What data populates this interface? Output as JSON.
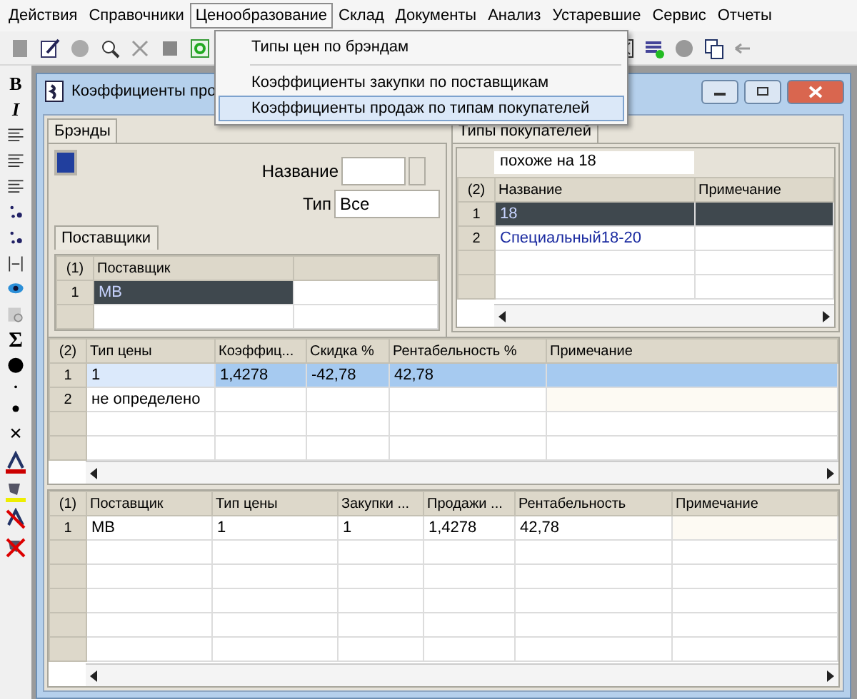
{
  "menu_bar": [
    {
      "label": "Действия",
      "selected": false
    },
    {
      "label": "Справочники",
      "selected": false
    },
    {
      "label": "Ценообразование",
      "selected": true
    },
    {
      "label": "Склад",
      "selected": false
    },
    {
      "label": "Документы",
      "selected": false
    },
    {
      "label": "Анализ",
      "selected": false
    },
    {
      "label": "Устаревшие",
      "selected": false
    },
    {
      "label": "Сервис",
      "selected": false
    },
    {
      "label": "Отчеты",
      "selected": false
    }
  ],
  "dropdown": [
    {
      "label": "Типы цен по брэндам",
      "selected": false,
      "separator_after": true
    },
    {
      "label": "Коэффициенты закупки по поставщикам",
      "selected": false,
      "separator_after": false
    },
    {
      "label": "Коэффициенты продаж по типам покупателей",
      "selected": true,
      "separator_after": false
    }
  ],
  "format_toolbar": {
    "bold": "B",
    "italic": "I",
    "sum": "Σ",
    "remove": "×"
  },
  "window": {
    "title": "Коэффициенты про"
  },
  "brands": {
    "tab": "Брэнды",
    "name_label": "Название",
    "type_label": "Тип",
    "type_value": "Все"
  },
  "suppliers": {
    "tab": "Поставщики",
    "count": "(1)",
    "columns": [
      "Поставщик"
    ],
    "rows": [
      {
        "number": "1",
        "cells": [
          "МВ"
        ],
        "selected": true
      }
    ]
  },
  "buyer_types": {
    "tab": "Типы покупателей",
    "filter": "похоже на 18",
    "count": "(2)",
    "columns": [
      "Название",
      "Примечание"
    ],
    "rows": [
      {
        "number": "1",
        "cells": [
          "18"
        ],
        "selected": true
      },
      {
        "number": "2",
        "cells": [
          "Специальный18-20"
        ],
        "selected": false
      }
    ]
  },
  "price_types": {
    "count": "(2)",
    "columns": [
      "Тип цены",
      "Коэффиц...",
      "Скидка %",
      "Рентабельность %",
      "Примечание"
    ],
    "rows": [
      {
        "number": "1",
        "cells": [
          "1",
          "1,4278",
          "-42,78",
          "42,78"
        ],
        "selected": true
      },
      {
        "number": "2",
        "cells": [
          "не определено"
        ],
        "selected": false
      }
    ]
  },
  "summary": {
    "count": "(1)",
    "columns": [
      "Поставщик",
      "Тип цены",
      "Закупки ...",
      "Продажи ...",
      "Рентабельность",
      "Примечание"
    ],
    "rows": [
      {
        "number": "1",
        "cells": [
          "МВ",
          "1",
          "1",
          "1,4278",
          "42,78"
        ],
        "selected": false
      }
    ]
  }
}
